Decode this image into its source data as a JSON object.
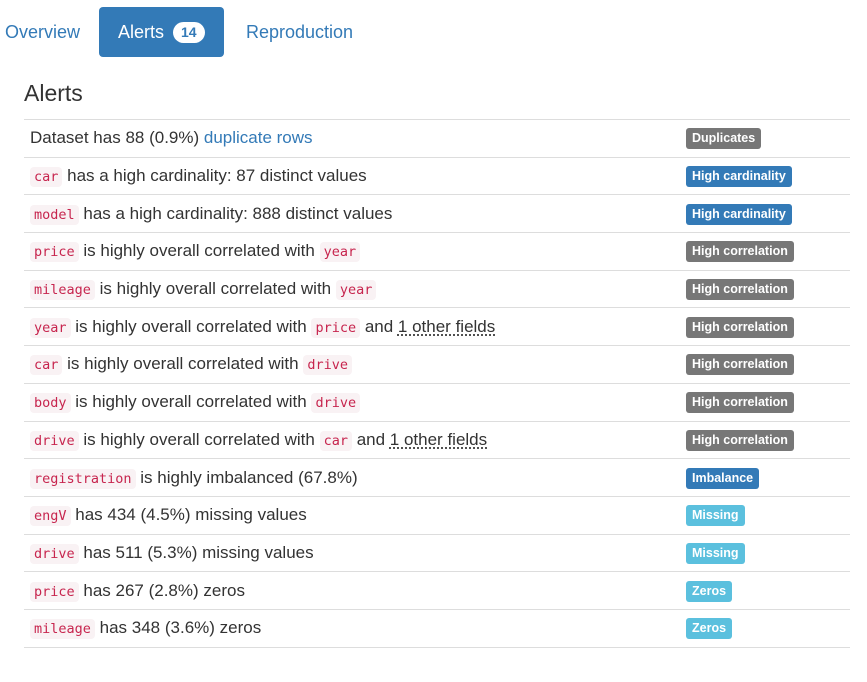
{
  "colors": {
    "primary": "#337ab7",
    "default": "#777777",
    "info": "#5bc0de",
    "code_text": "#c7254e",
    "code_bg": "#f9f2f4"
  },
  "tabs": [
    {
      "label": "Overview",
      "active": false
    },
    {
      "label": "Alerts",
      "active": true,
      "badge": "14"
    },
    {
      "label": "Reproduction",
      "active": false
    }
  ],
  "section_title": "Alerts",
  "alerts": [
    {
      "parts": [
        {
          "t": "text",
          "v": "Dataset has 88 (0.9%) "
        },
        {
          "t": "link",
          "v": "duplicate rows"
        }
      ],
      "label": "Duplicates",
      "label_color": "#777777"
    },
    {
      "parts": [
        {
          "t": "code",
          "v": "car"
        },
        {
          "t": "text",
          "v": " has a high cardinality: 87 distinct values"
        }
      ],
      "label": "High cardinality",
      "label_color": "#337ab7"
    },
    {
      "parts": [
        {
          "t": "code",
          "v": "model"
        },
        {
          "t": "text",
          "v": " has a high cardinality: 888 distinct values"
        }
      ],
      "label": "High cardinality",
      "label_color": "#337ab7"
    },
    {
      "parts": [
        {
          "t": "code",
          "v": "price"
        },
        {
          "t": "text",
          "v": " is highly overall correlated with "
        },
        {
          "t": "code",
          "v": "year"
        }
      ],
      "label": "High correlation",
      "label_color": "#777777"
    },
    {
      "parts": [
        {
          "t": "code",
          "v": "mileage"
        },
        {
          "t": "text",
          "v": " is highly overall correlated with "
        },
        {
          "t": "code",
          "v": "year"
        }
      ],
      "label": "High correlation",
      "label_color": "#777777"
    },
    {
      "parts": [
        {
          "t": "code",
          "v": "year"
        },
        {
          "t": "text",
          "v": " is highly overall correlated with "
        },
        {
          "t": "code",
          "v": "price"
        },
        {
          "t": "text",
          "v": " and "
        },
        {
          "t": "abbr",
          "v": "1 other fields"
        }
      ],
      "label": "High correlation",
      "label_color": "#777777"
    },
    {
      "parts": [
        {
          "t": "code",
          "v": "car"
        },
        {
          "t": "text",
          "v": " is highly overall correlated with "
        },
        {
          "t": "code",
          "v": "drive"
        }
      ],
      "label": "High correlation",
      "label_color": "#777777"
    },
    {
      "parts": [
        {
          "t": "code",
          "v": "body"
        },
        {
          "t": "text",
          "v": " is highly overall correlated with "
        },
        {
          "t": "code",
          "v": "drive"
        }
      ],
      "label": "High correlation",
      "label_color": "#777777"
    },
    {
      "parts": [
        {
          "t": "code",
          "v": "drive"
        },
        {
          "t": "text",
          "v": " is highly overall correlated with "
        },
        {
          "t": "code",
          "v": "car"
        },
        {
          "t": "text",
          "v": " and "
        },
        {
          "t": "abbr",
          "v": "1 other fields"
        }
      ],
      "label": "High correlation",
      "label_color": "#777777"
    },
    {
      "parts": [
        {
          "t": "code",
          "v": "registration"
        },
        {
          "t": "text",
          "v": " is highly imbalanced (67.8%)"
        }
      ],
      "label": "Imbalance",
      "label_color": "#337ab7"
    },
    {
      "parts": [
        {
          "t": "code",
          "v": "engV"
        },
        {
          "t": "text",
          "v": " has 434 (4.5%) missing values"
        }
      ],
      "label": "Missing",
      "label_color": "#5bc0de"
    },
    {
      "parts": [
        {
          "t": "code",
          "v": "drive"
        },
        {
          "t": "text",
          "v": " has 511 (5.3%) missing values"
        }
      ],
      "label": "Missing",
      "label_color": "#5bc0de"
    },
    {
      "parts": [
        {
          "t": "code",
          "v": "price"
        },
        {
          "t": "text",
          "v": " has 267 (2.8%) zeros"
        }
      ],
      "label": "Zeros",
      "label_color": "#5bc0de"
    },
    {
      "parts": [
        {
          "t": "code",
          "v": "mileage"
        },
        {
          "t": "text",
          "v": " has 348 (3.6%) zeros"
        }
      ],
      "label": "Zeros",
      "label_color": "#5bc0de"
    }
  ]
}
